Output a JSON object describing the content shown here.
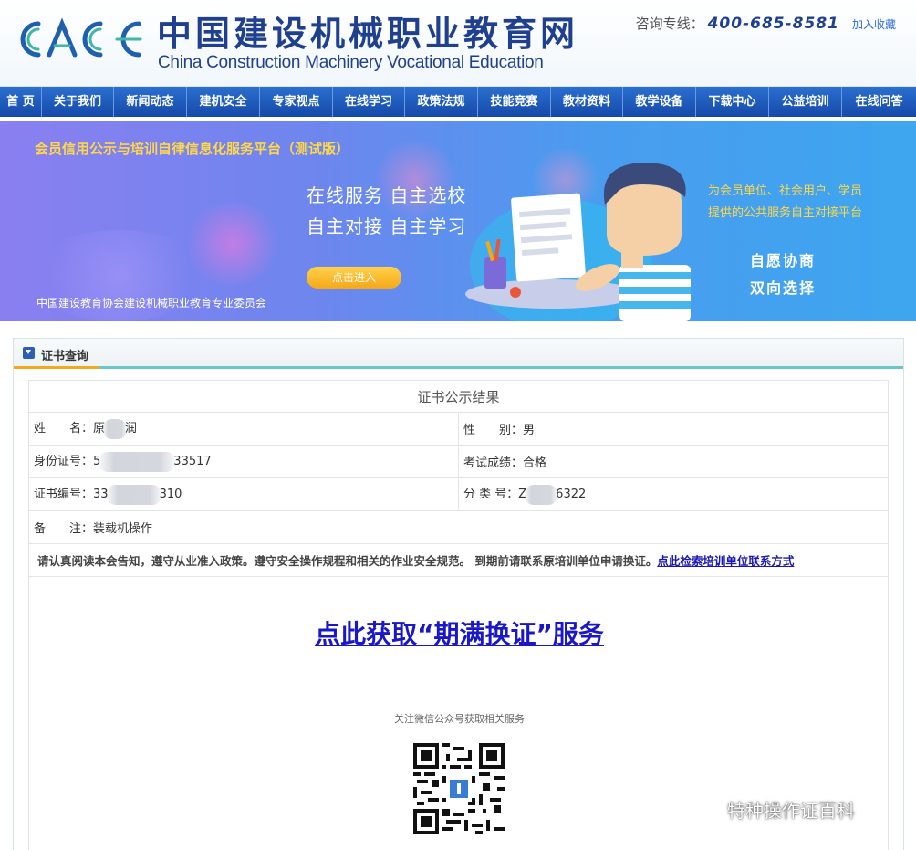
{
  "header": {
    "logo_text": "CACE",
    "title_cn": "中国建设机械职业教育网",
    "title_en": "China Construction Machinery Vocational Education",
    "hotline_label": "咨询专线：",
    "hotline_number": "400-685-8581",
    "favorite_label": "加入收藏"
  },
  "nav": {
    "items": [
      {
        "label": "首 页"
      },
      {
        "label": "关于我们"
      },
      {
        "label": "新闻动态"
      },
      {
        "label": "建机安全"
      },
      {
        "label": "专家视点"
      },
      {
        "label": "在线学习"
      },
      {
        "label": "政策法规"
      },
      {
        "label": "技能竞赛"
      },
      {
        "label": "教材资料"
      },
      {
        "label": "教学设备"
      },
      {
        "label": "下载中心"
      },
      {
        "label": "公益培训"
      },
      {
        "label": "在线问答"
      }
    ]
  },
  "banner": {
    "title": "会员信用公示与培训自律信息化服务平台（测试版）",
    "slogan1": "在线服务 自主选校",
    "slogan2": "自主对接 自主学习",
    "button": "点击进入",
    "org": "中国建设教育协会建设机械职业教育专业委员会",
    "right1": "为会员单位、社会用户、学员",
    "right2": "提供的公共服务自主对接平台",
    "right3": "自愿协商",
    "right4": "双向选择"
  },
  "panel": {
    "title": "证书查询"
  },
  "result": {
    "caption": "证书公示结果",
    "name_label": "姓　　名：",
    "name_pre": "原",
    "name_post": "润",
    "gender_label": "性　　别：",
    "gender": "男",
    "id_label": "身份证号：",
    "id_pre": "5",
    "id_post": "33517",
    "score_label": "考试成绩：",
    "score": "合格",
    "cert_label": "证书编号：",
    "cert_pre": "33",
    "cert_post": "310",
    "class_label": "分 类 号：",
    "class_pre": "Z",
    "class_post": "6322",
    "remark_label": "备　　注：",
    "remark": "装载机操作",
    "notice": "请认真阅读本会告知，遵守从业准入政策。遵守安全操作规程和相关的作业安全规范。 到期前请联系原培训单位申请换证。",
    "notice_link": "点此检索培训单位联系方式"
  },
  "service": {
    "link": "点此获取“期满换证”服务",
    "wechat_text": "关注微信公众号获取相关服务"
  },
  "watermark": {
    "text": "特种操作证百科"
  }
}
